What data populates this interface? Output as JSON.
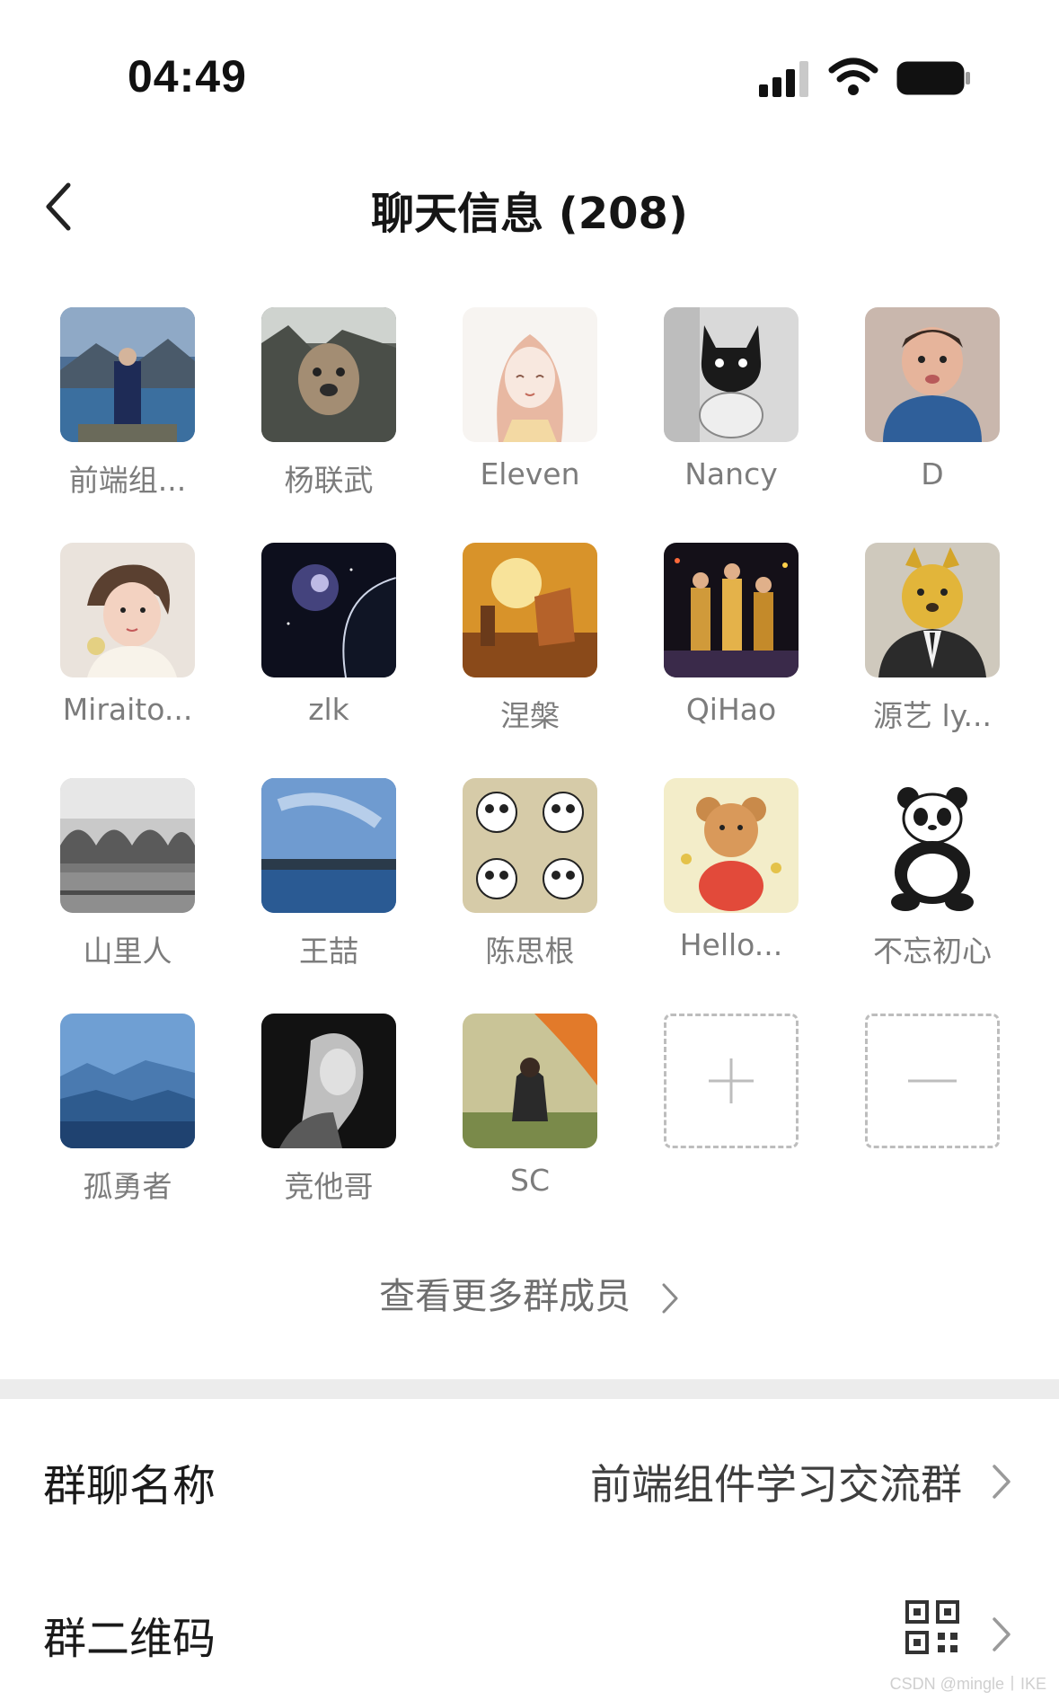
{
  "status_bar": {
    "time": "04:49"
  },
  "nav": {
    "title": "聊天信息 (208)"
  },
  "members": [
    {
      "name": "前端组...",
      "avatar": "landscape-person-icon"
    },
    {
      "name": "杨联武",
      "avatar": "dog-photo-icon"
    },
    {
      "name": "Eleven",
      "avatar": "anime-girl-sketch-icon"
    },
    {
      "name": "Nancy",
      "avatar": "black-cat-icon"
    },
    {
      "name": "D",
      "avatar": "child-photo-icon"
    },
    {
      "name": "Miraito...",
      "avatar": "girl-photo-icon"
    },
    {
      "name": "zlk",
      "avatar": "galaxy-planet-icon"
    },
    {
      "name": "涅槃",
      "avatar": "sunset-figure-icon"
    },
    {
      "name": "QiHao",
      "avatar": "dancers-photo-icon"
    },
    {
      "name": "源艺 ly...",
      "avatar": "suit-dog-icon"
    },
    {
      "name": "山里人",
      "avatar": "bridge-photo-icon"
    },
    {
      "name": "王喆",
      "avatar": "sky-lake-icon"
    },
    {
      "name": "陈思根",
      "avatar": "panda-collage-icon"
    },
    {
      "name": "Hello...",
      "avatar": "teddy-bear-icon"
    },
    {
      "name": "不忘初心",
      "avatar": "panda-cartoon-icon"
    },
    {
      "name": "孤勇者",
      "avatar": "blue-mountains-icon"
    },
    {
      "name": "竞他哥",
      "avatar": "bw-portrait-icon"
    },
    {
      "name": "SC",
      "avatar": "sitting-person-icon"
    }
  ],
  "actions": {
    "add": "add-member-icon",
    "remove": "remove-member-icon"
  },
  "more_members_label": "查看更多群成员",
  "settings": {
    "group_name_label": "群聊名称",
    "group_name_value": "前端组件学习交流群",
    "qr_label": "群二维码"
  },
  "watermark": "CSDN @mingle丨IKE",
  "colors": {
    "accent_text": "#1b1b1b",
    "secondary_text": "#7c7c7c",
    "divider": "#ececec"
  }
}
